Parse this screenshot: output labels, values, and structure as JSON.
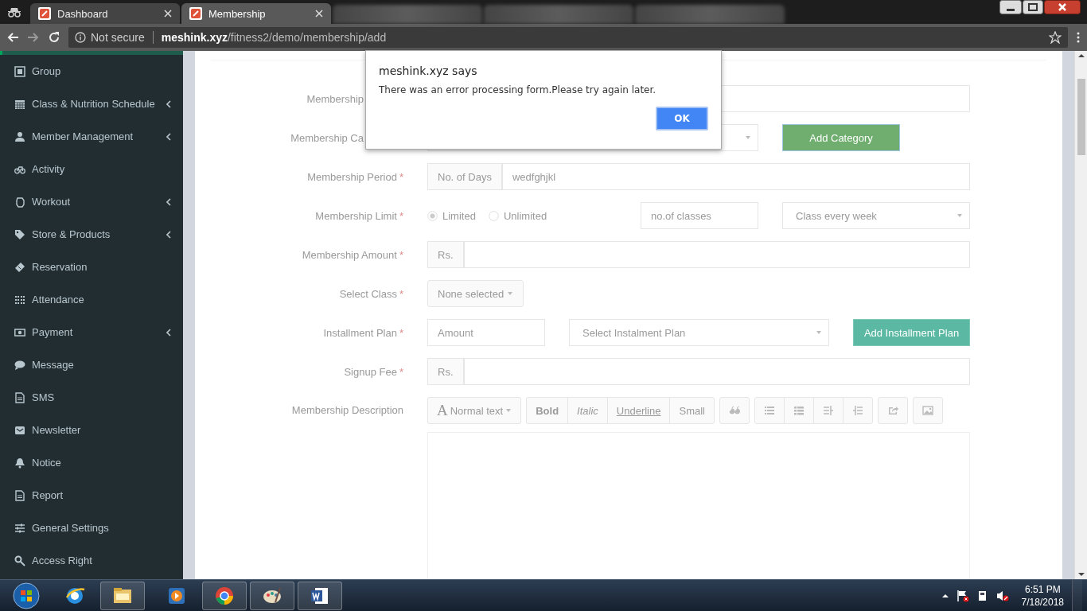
{
  "browser": {
    "tabs": [
      {
        "title": "Dashboard",
        "selected": false
      },
      {
        "title": "Membership",
        "selected": true
      }
    ],
    "address": {
      "security": "Not secure",
      "host": "meshink.xyz",
      "path": "/fitness2/demo/membership/add"
    }
  },
  "sidebar": {
    "items": [
      {
        "label": "Group",
        "submenu": false
      },
      {
        "label": "Class & Nutrition Schedule",
        "submenu": true
      },
      {
        "label": "Member Management",
        "submenu": true
      },
      {
        "label": "Activity",
        "submenu": false
      },
      {
        "label": "Workout",
        "submenu": true
      },
      {
        "label": "Store & Products",
        "submenu": true
      },
      {
        "label": "Reservation",
        "submenu": false
      },
      {
        "label": "Attendance",
        "submenu": false
      },
      {
        "label": "Payment",
        "submenu": true
      },
      {
        "label": "Message",
        "submenu": false
      },
      {
        "label": "SMS",
        "submenu": false
      },
      {
        "label": "Newsletter",
        "submenu": false
      },
      {
        "label": "Notice",
        "submenu": false
      },
      {
        "label": "Report",
        "submenu": false
      },
      {
        "label": "General Settings",
        "submenu": false
      },
      {
        "label": "Access Right",
        "submenu": false
      }
    ]
  },
  "form": {
    "rows": [
      {
        "kind": "text",
        "label": "Membership",
        "cut_by_dialog": true
      },
      {
        "kind": "category",
        "label": "Membership Ca",
        "cut_by_dialog": true,
        "button": "Add Category"
      },
      {
        "kind": "addon",
        "label": "Membership Period",
        "required_mark": "*",
        "addon": "No. of Days",
        "value": "wedfghjkl"
      },
      {
        "kind": "limit",
        "label": "Membership Limit",
        "required_mark": "*",
        "options": [
          {
            "label": "Limited",
            "selected": true
          },
          {
            "label": "Unlimited",
            "selected": false
          }
        ],
        "count_placeholder": "no.of classes",
        "frequency": "Class every week"
      },
      {
        "kind": "addon",
        "label": "Membership Amount",
        "required_mark": "*",
        "addon": "Rs."
      },
      {
        "kind": "multiselect",
        "label": "Select Class",
        "required_mark": "*",
        "value": "None selected"
      },
      {
        "kind": "installment",
        "label": "Installment Plan",
        "required_mark": "*",
        "amount_placeholder": "Amount",
        "plan": "Select Instalment Plan",
        "button": "Add Installment Plan"
      },
      {
        "kind": "addon",
        "label": "Signup Fee",
        "required_mark": "*",
        "addon": "Rs."
      },
      {
        "kind": "editor",
        "label": "Membership Description",
        "font_glyph": "A",
        "style_menu": "Normal text",
        "styles": [
          "Bold",
          "Italic",
          "Underline",
          "Small"
        ]
      }
    ]
  },
  "dialog": {
    "title": "meshink.xyz says",
    "message": "There was an error processing form.Please try again later.",
    "button": "OK"
  },
  "taskbar": {
    "time": "6:51 PM",
    "date": "7/18/2018"
  }
}
